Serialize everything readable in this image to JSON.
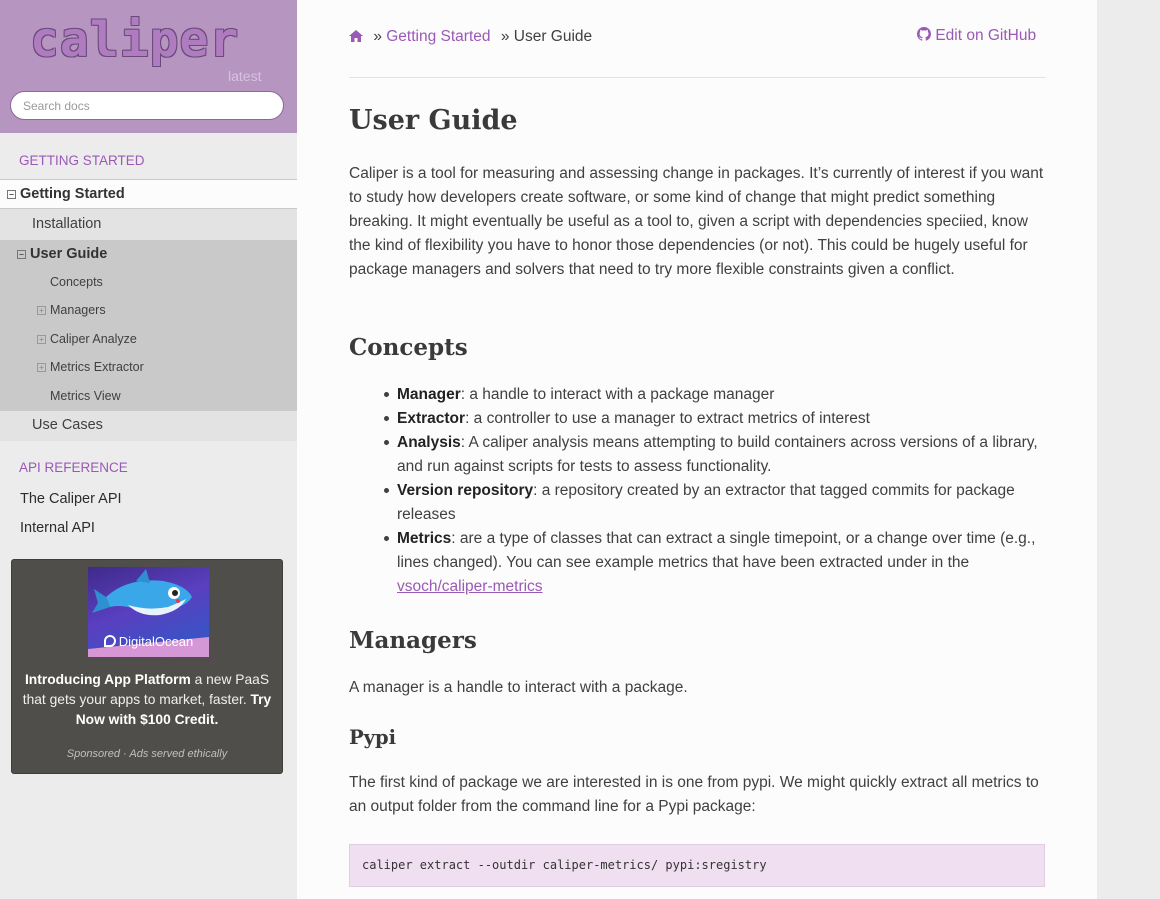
{
  "sidebar": {
    "logo_text": "caliper",
    "version": "latest",
    "search_placeholder": "Search docs",
    "caption_getting_started": "GETTING STARTED",
    "nav_getting_started": "Getting Started",
    "nav_installation": "Installation",
    "nav_user_guide": "User Guide",
    "sub_items": [
      {
        "label": "Concepts"
      },
      {
        "label": "Managers"
      },
      {
        "label": "Caliper Analyze"
      },
      {
        "label": "Metrics Extractor"
      },
      {
        "label": "Metrics View"
      }
    ],
    "nav_use_cases": "Use Cases",
    "caption_api_reference": "API REFERENCE",
    "api_items": [
      {
        "label": "The Caliper API"
      },
      {
        "label": "Internal API"
      }
    ],
    "toggle_open": "⊟",
    "toggle_closed": "⊞"
  },
  "ad": {
    "brand": "DigitalOcean",
    "strong1": "Introducing App Platform",
    "text1": " a new PaaS that gets your apps to market, faster. ",
    "strong2": "Try Now with $100 Credit.",
    "footer": "Sponsored · Ads served ethically"
  },
  "breadcrumb": {
    "home_icon": "home-icon",
    "sep": "»",
    "link": "Getting Started",
    "current": "User Guide"
  },
  "edit_github": "Edit on GitHub",
  "content": {
    "title": "User Guide",
    "intro": "Caliper is a tool for measuring and assessing change in packages. It’s currently of interest if you want to study how developers create software, or some kind of change that might predict something breaking. It might eventually be useful as a tool to, given a script with dependencies speciied, know the kind of flexibility you have to honor those dependencies (or not). This could be hugely useful for package managers and solvers that need to try more flexible constraints given a conflict.",
    "concepts_heading": "Concepts",
    "concepts": [
      {
        "term": "Manager",
        "desc": ": a handle to interact with a package manager"
      },
      {
        "term": "Extractor",
        "desc": ": a controller to use a manager to extract metrics of interest"
      },
      {
        "term": "Analysis",
        "desc": ": A caliper analysis means attempting to build containers across versions of a library, and run against scripts for tests to assess functionality."
      },
      {
        "term": "Version repository",
        "desc": ": a repository created by an extractor that tagged commits for package releases"
      },
      {
        "term": "Metrics",
        "desc": ": are a type of classes that can extract a single timepoint, or a change over time (e.g., lines changed). You can see example metrics that have been extracted under in the "
      }
    ],
    "metrics_link": "vsoch/caliper-metrics",
    "managers_heading": "Managers",
    "managers_text": "A manager is a handle to interact with a package.",
    "pypi_heading": "Pypi",
    "pypi_text": "The first kind of package we are interested in is one from pypi. We might quickly extract all metrics to an output folder from the command line for a Pypi package:",
    "code": "caliper extract --outdir caliper-metrics/ pypi:sregistry"
  }
}
